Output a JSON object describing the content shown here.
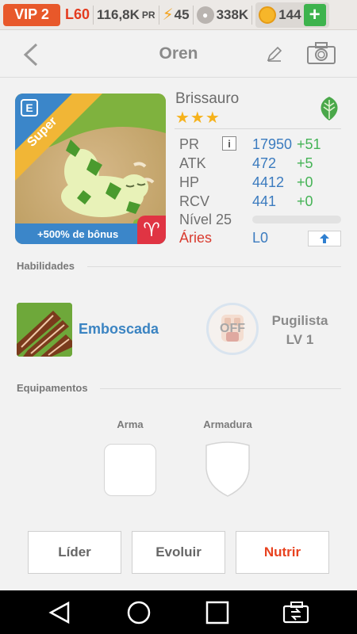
{
  "topbar": {
    "vip": "VIP 2",
    "level": "L60",
    "power": "116,8K",
    "power_unit": "PR",
    "energy": "45",
    "food": "338K",
    "coins": "144"
  },
  "header": {
    "title": "Oren"
  },
  "monster": {
    "name": "Brissauro",
    "stars": "★★★",
    "rarity": "Super",
    "bonus": "+500% de bônus",
    "element": "leaf",
    "stats": [
      {
        "label": "PR",
        "value": "17950",
        "bonus": "+51"
      },
      {
        "label": "ATK",
        "value": "472",
        "bonus": "+5"
      },
      {
        "label": "HP",
        "value": "4412",
        "bonus": "+0"
      },
      {
        "label": "RCV",
        "value": "441",
        "bonus": "+0"
      }
    ],
    "level_label": "Nível 25",
    "level_progress": 0,
    "sign_label": "Áries",
    "sign_level": "L0"
  },
  "skills": {
    "title": "Habilidades",
    "active": {
      "name": "Emboscada"
    },
    "passive": {
      "status": "OFF",
      "name": "Pugilista",
      "level": "LV 1"
    }
  },
  "equipment": {
    "title": "Equipamentos",
    "weapon_label": "Arma",
    "armor_label": "Armadura"
  },
  "actions": {
    "leader": "Líder",
    "evolve": "Evoluir",
    "feed": "Nutrir"
  },
  "colors": {
    "accent_orange": "#e8582a",
    "feed_red": "#e8421f",
    "stat_blue": "#3b7bbf",
    "bonus_green": "#45b356"
  }
}
